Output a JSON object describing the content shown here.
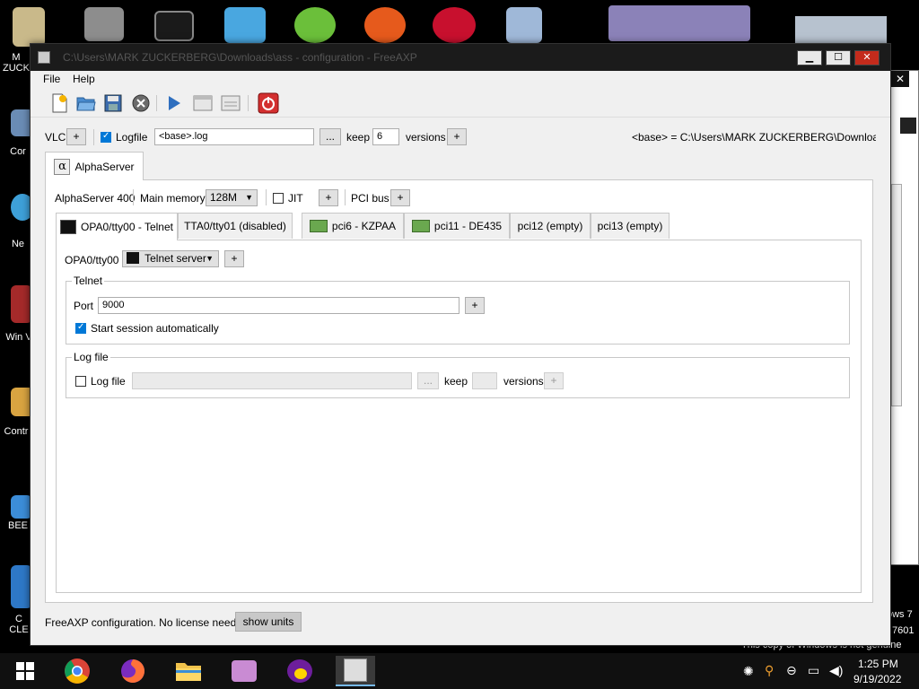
{
  "desktop": {
    "labels": [
      "M ZUCK",
      "Cor",
      "Ne",
      "Win V",
      "Contr",
      "BEE",
      "C CLE"
    ],
    "watermark": "This copy of Windows is not genuine",
    "os_version_fragment": "ows 7",
    "build_fragment": "7601"
  },
  "window": {
    "title": "C:\\Users\\MARK ZUCKERBERG\\Downloads\\ass - configuration - FreeAXP",
    "controls": {
      "minimize": "▁",
      "maximize": "☐",
      "close": "✕"
    }
  },
  "menu": [
    "File",
    "Help"
  ],
  "toolbar": {
    "icons": [
      "new-icon",
      "open-icon",
      "save-icon",
      "close-config-icon",
      "run-icon",
      "window-icon",
      "panel-icon",
      "power-icon"
    ]
  },
  "top_row": {
    "vlc_label": "VLC",
    "plus": "+",
    "logfile_label": "Logfile",
    "logfile_checked": true,
    "logfile_value": "<base>.log",
    "browse": "...",
    "keep_label": "keep",
    "keep_value": "6",
    "versions_label": "versions",
    "base_info": "<base> = C:\\Users\\MARK ZUCKERBERG\\Downloads\\ass"
  },
  "server_tab": {
    "label": "AlphaServer"
  },
  "system_row": {
    "model": "AlphaServer 400",
    "memory_label": "Main memory:",
    "memory_value": "128M",
    "jit_label": "JIT",
    "pci_label": "PCI bus"
  },
  "device_tabs": [
    {
      "label": "OPA0/tty00 - Telnet",
      "active": true
    },
    {
      "label": "TTA0/tty01 (disabled)",
      "active": false
    },
    {
      "label": "pci6 - KZPAA",
      "active": false
    },
    {
      "label": "pci11 - DE435",
      "active": false
    },
    {
      "label": "pci12 (empty)",
      "active": false
    },
    {
      "label": "pci13 (empty)",
      "active": false
    }
  ],
  "device_panel": {
    "port_label": "OPA0/tty00",
    "type_value": "Telnet server",
    "telnet_group": "Telnet",
    "port_field_label": "Port",
    "port_value": "9000",
    "autostart_label": "Start session automatically",
    "autostart_checked": true,
    "logfile_group": "Log file",
    "logfile_label": "Log file",
    "logfile_checked": false,
    "logfile_value": "",
    "browse": "...",
    "keep_label": "keep",
    "keep_value": "",
    "versions_label": "versions"
  },
  "status": {
    "text": "FreeAXP configuration. No license needed.",
    "show_units": "show units"
  },
  "taskbar": {
    "time": "1:25 PM",
    "date": "9/19/2022"
  },
  "colors": {
    "window_bg": "#f0f0f0",
    "accent": "#0078d7",
    "close_red": "#c42b1c",
    "power_red": "#d32f2f",
    "taskbar": "#101010"
  }
}
